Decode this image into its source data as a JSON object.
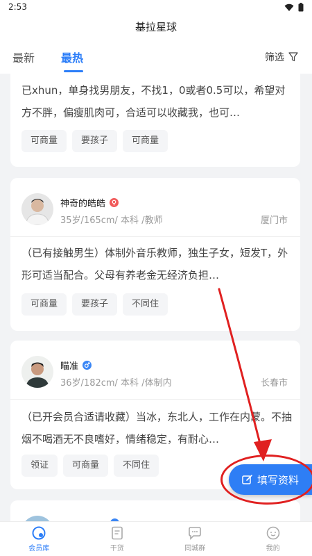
{
  "status": {
    "time": "2:53"
  },
  "header": {
    "title": "基拉星球"
  },
  "tabs": [
    {
      "label": "最新"
    },
    {
      "label": "最热"
    }
  ],
  "filter": {
    "label": "筛选"
  },
  "cards": [
    {
      "desc": "已xhun，单身找男朋友，不找1，0或者0.5可以，希望对方不胖，偏瘦肌肉可，合适可以收藏我，也可…",
      "tags": [
        "可商量",
        "要孩子",
        "可商量"
      ]
    },
    {
      "name": "神奇的皓皓",
      "meta": "35岁/165cm/ 本科 /教师",
      "city": "厦门市",
      "desc": "（已有接触男生）体制外音乐教师，独生子女，短发T，外形可适当配合。父母有养老金无经济负担…",
      "tags": [
        "可商量",
        "要孩子",
        "不同住"
      ],
      "badge_color": "#f15a5a"
    },
    {
      "name": "瞄准",
      "meta": "36岁/182cm/ 本科 /体制内",
      "city": "长春市",
      "desc": "（已开会员合适请收藏）当冰，东北人，工作在内蒙。不抽烟不喝酒无不良嗜好，情绪稳定，有耐心…",
      "tags": [
        "领证",
        "可商量",
        "不同住"
      ],
      "badge_color": "#3a86f5"
    }
  ],
  "fab": {
    "label": "填写资料"
  },
  "bottom_nav": [
    {
      "label": "会员库",
      "icon": "member-icon"
    },
    {
      "label": "干货",
      "icon": "document-icon"
    },
    {
      "label": "同城群",
      "icon": "chat-icon"
    },
    {
      "label": "我的",
      "icon": "profile-icon"
    }
  ],
  "colors": {
    "accent": "#2c7ef8",
    "annotation": "#e02020"
  }
}
